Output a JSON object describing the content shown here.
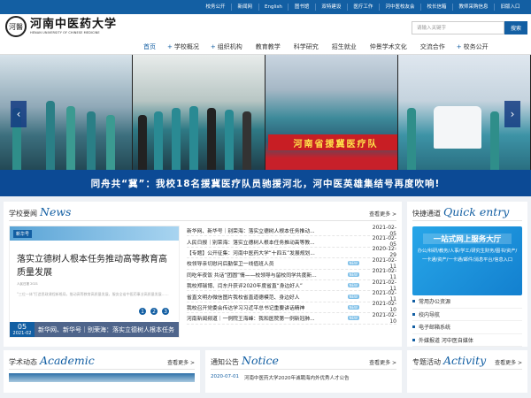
{
  "topbar": [
    "校务公开",
    "新闻网",
    "English",
    "图书馆",
    "双特建设",
    "医疗工作",
    "河中医校友会",
    "校长信箱",
    "教师采购信息",
    "旧版入口"
  ],
  "logo": {
    "seal": "河醫",
    "cn": "河南中医药大学",
    "en": "HENAN UNIVERSITY OF CHINESE MEDICINE"
  },
  "search": {
    "placeholder": "请输入关键字",
    "button": "搜索"
  },
  "nav": [
    {
      "label": "首页",
      "plus": ""
    },
    {
      "label": "学校概况",
      "plus": "+"
    },
    {
      "label": "组织机构",
      "plus": "+"
    },
    {
      "label": "教育教学",
      "plus": ""
    },
    {
      "label": "科学研究",
      "plus": ""
    },
    {
      "label": "招生就业",
      "plus": ""
    },
    {
      "label": "仲景学术文化",
      "plus": ""
    },
    {
      "label": "交流合作",
      "plus": ""
    },
    {
      "label": "校务公开",
      "plus": "+"
    }
  ],
  "banner": {
    "sign": "河南省援冀医疗队",
    "prev": "‹",
    "next": "›"
  },
  "slogan": "同舟共“冀”：我校18名援冀医疗队员驰援河北，河中医英雄集结号再度吹响!",
  "news": {
    "title_cn": "学校要闻",
    "title_en": "News",
    "more": "查看更多 >",
    "feature": {
      "badge": "新华号",
      "headline": "落实立德树人根本任务推动高等教育高质量发展",
      "meta": "人民日报 2021",
      "text": "\"三位一体\"打造思政课程新格局，推动高等教育高质量发展，服务全省中医药事业高质量发展……",
      "cap_day": "05",
      "cap_month": "2021-02",
      "cap_title": "新华网、新华号｜别荣海：落实立德树人根本任务",
      "dots": [
        "1",
        "2",
        "3"
      ]
    },
    "items": [
      {
        "title": "新华网、新华号｜别荣海：落实立德树人根本任务推动...",
        "date": "2021-02-05",
        "new": false
      },
      {
        "title": "人民日报｜别荣海：落实立德树人根本任务推动高等教...",
        "date": "2021-02-05",
        "new": false
      },
      {
        "title": "【专题】公开征集：河南中医药大学“十四五”发展规划...",
        "date": "2020-12-29",
        "new": false
      },
      {
        "title": "校领导亲切慰问后勤保卫一线值班人员",
        "date": "2021-02-11",
        "new": true
      },
      {
        "title": "同吃年夜饭 共话“团圆”情——校领导与留校同学共度新...",
        "date": "2021-02-11",
        "new": true
      },
      {
        "title": "我校郑瑞博、闫东升获评2020年度省直“身边好人”",
        "date": "2021-02-11",
        "new": true
      },
      {
        "title": "省直文明办微信图片我校省直道德模范、身边好人",
        "date": "2021-02-11",
        "new": true
      },
      {
        "title": "我校召开党委会传达学习习近平总书记重要讲话精神",
        "date": "2021-02-10",
        "new": true
      },
      {
        "title": "河南新闻频道｜一例院王海峰：我和医院第一例新冠肺...",
        "date": "2021-02-10",
        "new": true
      }
    ]
  },
  "quick": {
    "title_cn": "快捷通道",
    "title_en": "Quick entry",
    "banner_title": "一站式网上服务大厅",
    "banner_text": "办公/科研/教务/人事/学工/研究生财务/图书/资产/一卡通/资产/一卡通/邮件/消息平台/信息入口",
    "items": [
      "常用办公资源",
      "校内导航",
      "电子邮箱系统",
      "外媒报道 河中医自媒体"
    ]
  },
  "bottom": {
    "academic": {
      "title_cn": "学术动态",
      "title_en": "Academic",
      "more": "查看更多 >"
    },
    "notice": {
      "title_cn": "通知公告",
      "title_en": "Notice",
      "more": "查看更多 >",
      "date": "2020-07-01",
      "text": "河南中医药大学2020年诚聘海内外优秀人才公告"
    },
    "activity": {
      "title_cn": "专题活动",
      "title_en": "Activity",
      "more": "查看更多 >"
    }
  }
}
